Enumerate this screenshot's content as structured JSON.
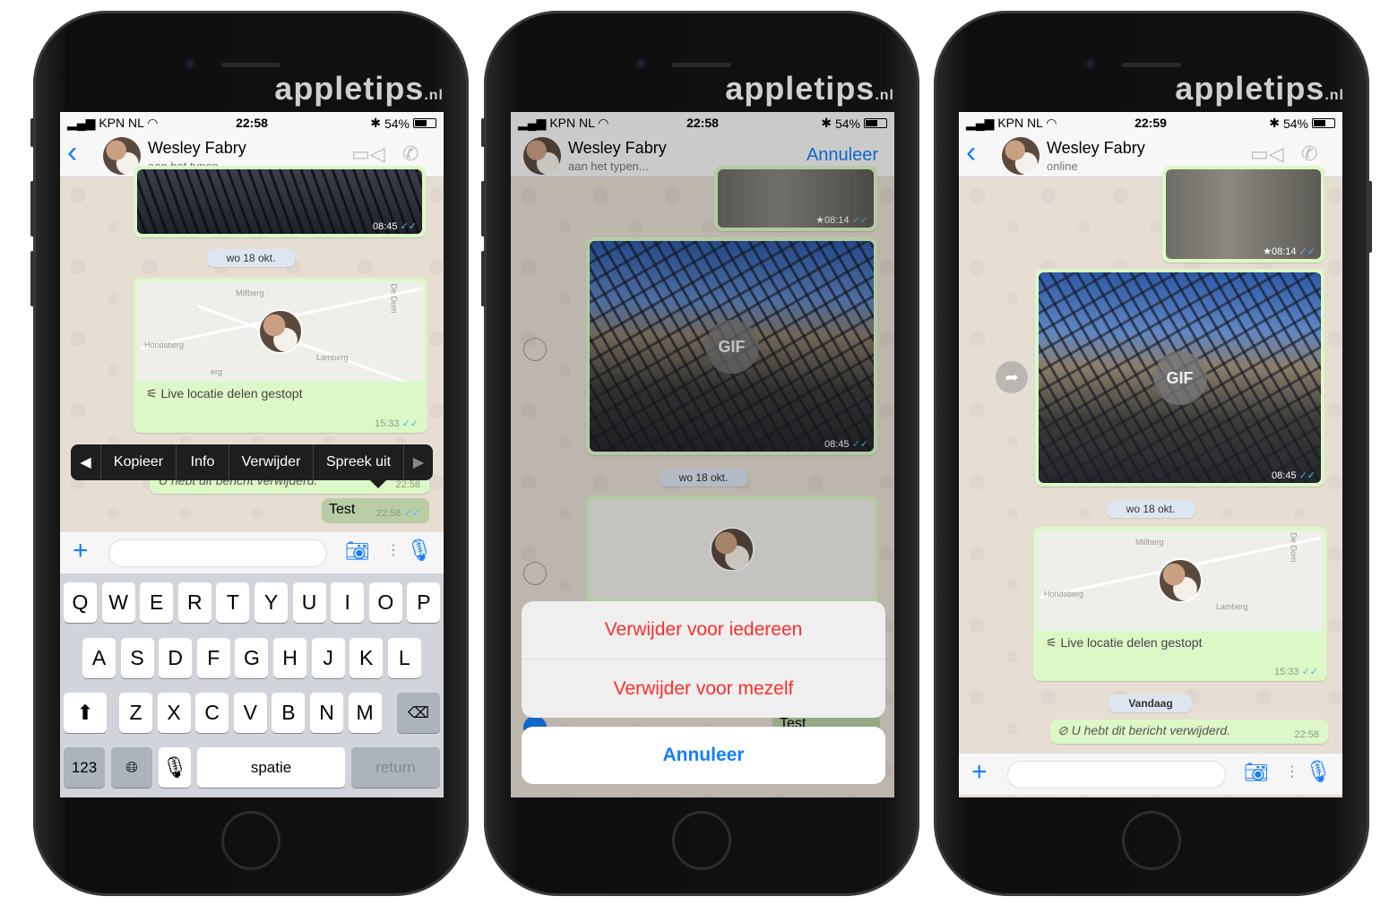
{
  "brand": {
    "logo": "appletips",
    "logo_suffix": ".nl"
  },
  "colors": {
    "accent": "#157efb",
    "destructive": "#fe2d2d",
    "bubble_out": "#dcf8c6",
    "chat_bg": "#e6ded3",
    "read_ticks": "#4fb6ec"
  },
  "phones": [
    {
      "status": {
        "carrier": "KPN NL",
        "time": "22:58",
        "battery": "54%"
      },
      "header": {
        "name": "Wesley Fabry",
        "subtitle": "aan het typen..."
      },
      "messages": {
        "photo_time": "08:45",
        "date": "wo 18 okt.",
        "location_text": "Live locatie delen gestopt",
        "location_time": "15:33",
        "deleted_text": "U hebt dit bericht verwijderd.",
        "deleted_time": "22:58",
        "test_text": "Test",
        "test_time": "22:58"
      },
      "map_labels": [
        "Millberg",
        "De Dom",
        "Hondsberg",
        "Lamberg",
        "erg"
      ],
      "context_menu": [
        "Kopieer",
        "Info",
        "Verwijder",
        "Spreek uit"
      ],
      "keyboard": {
        "row1": [
          "Q",
          "W",
          "E",
          "R",
          "T",
          "Y",
          "U",
          "I",
          "O",
          "P"
        ],
        "row2": [
          "A",
          "S",
          "D",
          "F",
          "G",
          "H",
          "J",
          "K",
          "L"
        ],
        "row3": [
          "Z",
          "X",
          "C",
          "V",
          "B",
          "N",
          "M"
        ],
        "numbers": "123",
        "space": "spatie",
        "return": "return"
      }
    },
    {
      "status": {
        "carrier": "KPN NL",
        "time": "22:58",
        "battery": "54%"
      },
      "header": {
        "name": "Wesley Fabry",
        "subtitle": "aan het typen...",
        "cancel": "Annuleer"
      },
      "messages": {
        "photo_time": "08:14",
        "gif_label": "GIF",
        "gif_time": "08:45",
        "date": "wo 18 okt.",
        "test_text": "Test"
      },
      "action_sheet": {
        "option1": "Verwijder voor iedereen",
        "option2": "Verwijder voor mezelf",
        "cancel": "Annuleer"
      }
    },
    {
      "status": {
        "carrier": "KPN NL",
        "time": "22:59",
        "battery": "54%"
      },
      "header": {
        "name": "Wesley Fabry",
        "subtitle": "online"
      },
      "messages": {
        "photo_time": "08:14",
        "gif_label": "GIF",
        "gif_time": "08:45",
        "date": "wo 18 okt.",
        "location_text": "Live locatie delen gestopt",
        "location_time": "15:33",
        "today": "Vandaag",
        "deleted_text": "U hebt dit bericht verwijderd.",
        "deleted_time": "22:58"
      }
    }
  ]
}
